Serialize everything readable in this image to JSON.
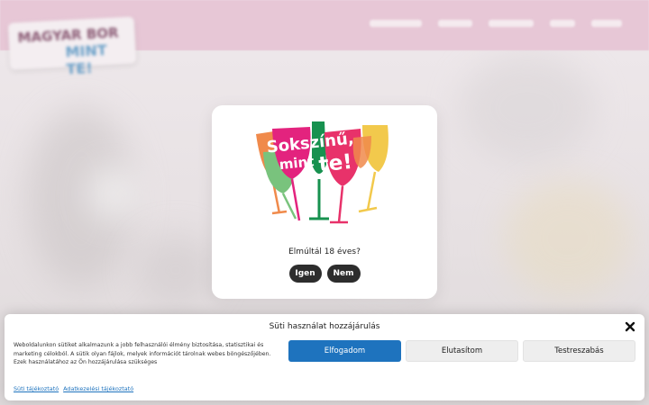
{
  "age_gate": {
    "logo_alt": "Sokszínű, mint te!",
    "logo_line1": "Sokszínű,",
    "logo_line2": "mint",
    "logo_line3": "te!",
    "question": "Elmúltál 18 éves?",
    "yes_label": "Igen",
    "no_label": "Nem",
    "glass_colors": [
      "#f08a4b",
      "#79c37d",
      "#17914f",
      "#e8326a",
      "#f2c94c",
      "#e3237e"
    ]
  },
  "cookie_banner": {
    "title": "Süti használat hozzájárulás",
    "text": "Weboldalunkon sütiket alkalmazunk a jobb felhasználói élmény biztosítása, statisztikai és marketing célokból. A sütik olyan fájlok, melyek információt tárolnak webes böngészőjében. Ezek használatához az Ön hozzájárulása szükséges",
    "accept_label": "Elfogadom",
    "deny_label": "Elutasítom",
    "prefs_label": "Testreszabás",
    "link_cookie_policy": "Süti tájékoztató",
    "link_privacy": "Adatkezelési tájékoztató",
    "accent_color": "#1e73be"
  }
}
